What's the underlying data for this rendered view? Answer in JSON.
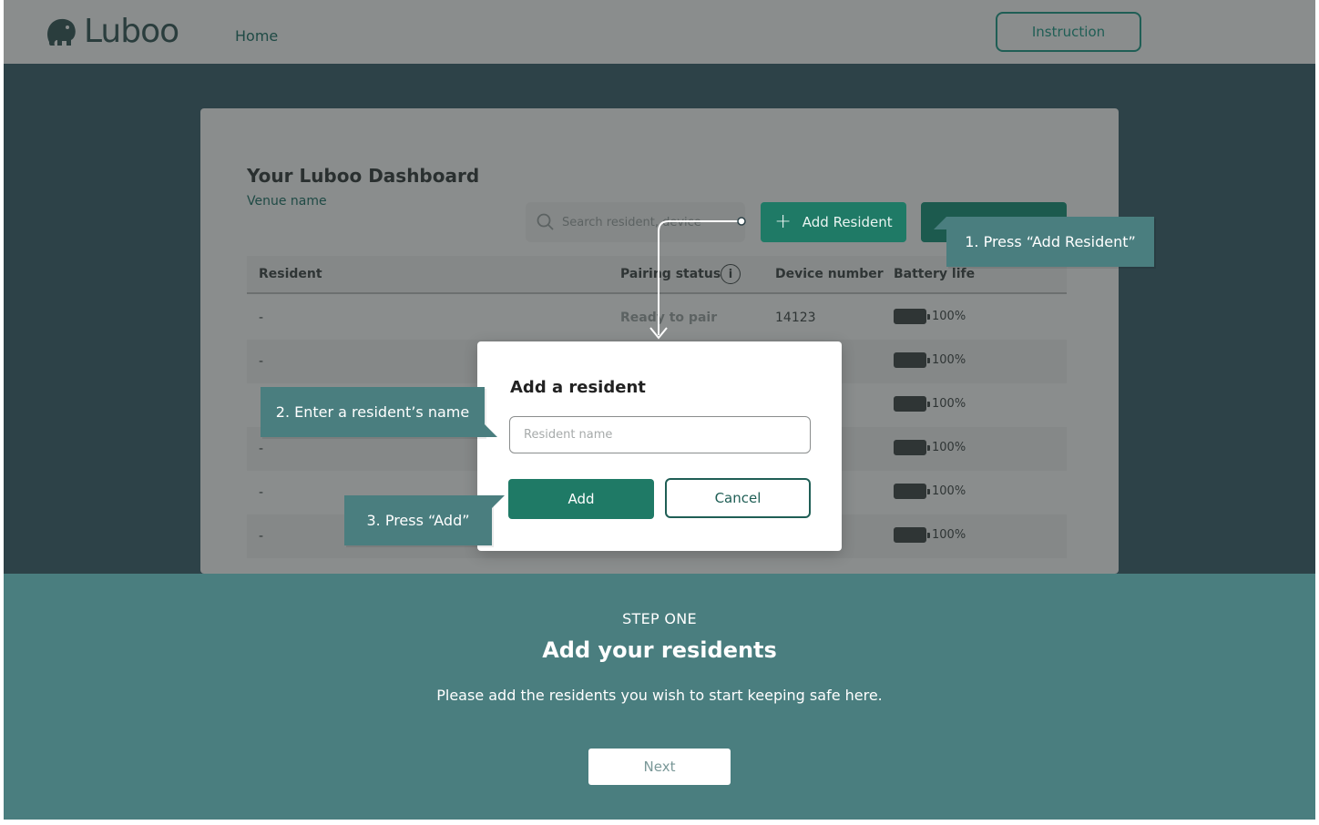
{
  "app": {
    "brand": "Luboo"
  },
  "nav": {
    "home_label": "Home",
    "instruction_label": "Instruction"
  },
  "dashboard": {
    "title": "Your Luboo Dashboard",
    "venue": "Venue name",
    "search_placeholder": "Search resident, device",
    "add_resident_label": "Add Resident",
    "columns": {
      "resident": "Resident",
      "pairing_status": "Pairing status",
      "device_number": "Device number",
      "battery_life": "Battery life"
    },
    "rows": [
      {
        "resident": "-",
        "pairing_status": "Ready to pair",
        "device_number": "14123",
        "battery": "100%"
      },
      {
        "resident": "-",
        "pairing_status": "",
        "device_number": "",
        "battery": "100%"
      },
      {
        "resident": "",
        "pairing_status": "",
        "device_number": "",
        "battery": "100%"
      },
      {
        "resident": "-",
        "pairing_status": "",
        "device_number": "",
        "battery": "100%"
      },
      {
        "resident": "-",
        "pairing_status": "",
        "device_number": "",
        "battery": "100%"
      },
      {
        "resident": "-",
        "pairing_status": "",
        "device_number": "",
        "battery": "100%"
      }
    ]
  },
  "modal": {
    "title": "Add a resident",
    "input_placeholder": "Resident name",
    "add_label": "Add",
    "cancel_label": "Cancel"
  },
  "callouts": {
    "step1": "1. Press “Add Resident”",
    "step2": "2. Enter a resident’s name",
    "step3": "3. Press “Add”"
  },
  "onboarding": {
    "step_label": "STEP ONE",
    "title": "Add your residents",
    "description": "Please add the residents you wish to start keeping safe here.",
    "next_label": "Next"
  },
  "colors": {
    "accent": "#1f7a66",
    "panel": "#4a7e7f",
    "dark_band": "#2d4248",
    "overlay": "#8a8d8d"
  }
}
